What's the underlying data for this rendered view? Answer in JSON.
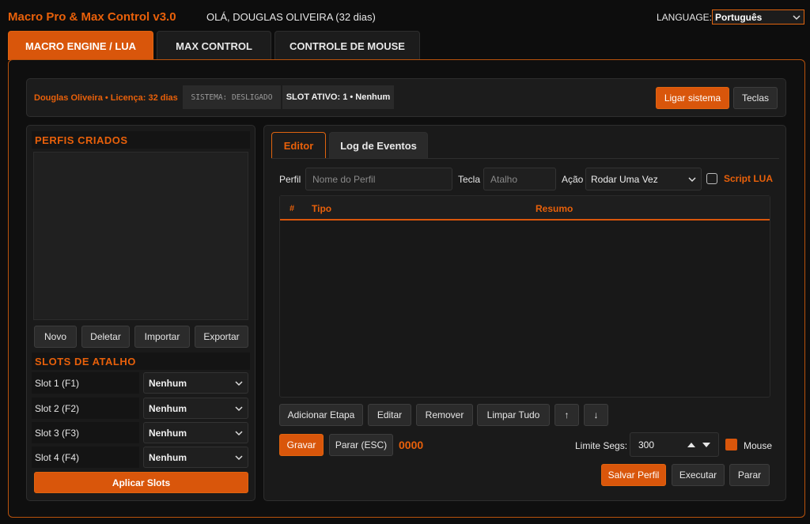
{
  "window": {
    "title": "Macro Pro & Max Control v3.0",
    "greeting": "OLÁ, DOUGLAS OLIVEIRA (32 dias)",
    "language_label": "LANGUAGE:",
    "language_value": "Português"
  },
  "main_tabs": [
    {
      "label": "MACRO ENGINE / LUA",
      "active": true
    },
    {
      "label": "MAX CONTROL",
      "active": false
    },
    {
      "label": "CONTROLE DE MOUSE",
      "active": false
    }
  ],
  "status_bar": {
    "license": "Douglas Oliveira • Licença: 32 dias",
    "system": "SISTEMA: DESLIGADO",
    "slot": "SLOT ATIVO: 1 • Nenhum",
    "power_button": "Ligar sistema",
    "keys_button": "Teclas"
  },
  "profiles": {
    "title": "PERFIS CRIADOS",
    "items": [],
    "buttons": {
      "new": "Novo",
      "delete": "Deletar",
      "import": "Importar",
      "export": "Exportar"
    }
  },
  "slots": {
    "title": "SLOTS DE ATALHO",
    "items": [
      {
        "label": "Slot 1 (F1)",
        "value": "Nenhum"
      },
      {
        "label": "Slot 2 (F2)",
        "value": "Nenhum"
      },
      {
        "label": "Slot 3 (F3)",
        "value": "Nenhum"
      },
      {
        "label": "Slot 4 (F4)",
        "value": "Nenhum"
      }
    ],
    "apply_button": "Aplicar Slots"
  },
  "editor": {
    "tabs": [
      {
        "label": "Editor",
        "active": true
      },
      {
        "label": "Log de Eventos",
        "active": false
      }
    ],
    "profile_label": "Perfil",
    "profile_placeholder": "Nome do Perfil",
    "key_label": "Tecla",
    "key_placeholder": "Atalho",
    "action_label": "Ação",
    "action_value": "Rodar Uma Vez",
    "script_lua_label": "Script LUA",
    "table": {
      "columns": [
        "#",
        "Tipo",
        "Resumo"
      ],
      "rows": []
    },
    "step_buttons": {
      "add": "Adicionar Etapa",
      "edit": "Editar",
      "remove": "Remover",
      "clear": "Limpar Tudo",
      "up": "↑",
      "down": "↓"
    },
    "record_button": "Gravar",
    "stop_esc_button": "Parar (ESC)",
    "counter": "0000",
    "limit_label": "Limite Segs:",
    "limit_value": "300",
    "mouse_label": "Mouse",
    "save_button": "Salvar Perfil",
    "run_button": "Executar",
    "stop_button": "Parar"
  },
  "colors": {
    "accent": "#d9560b",
    "accent_text": "#e8600a",
    "background": "#0d0d0d",
    "panel": "#1a1a1a"
  }
}
